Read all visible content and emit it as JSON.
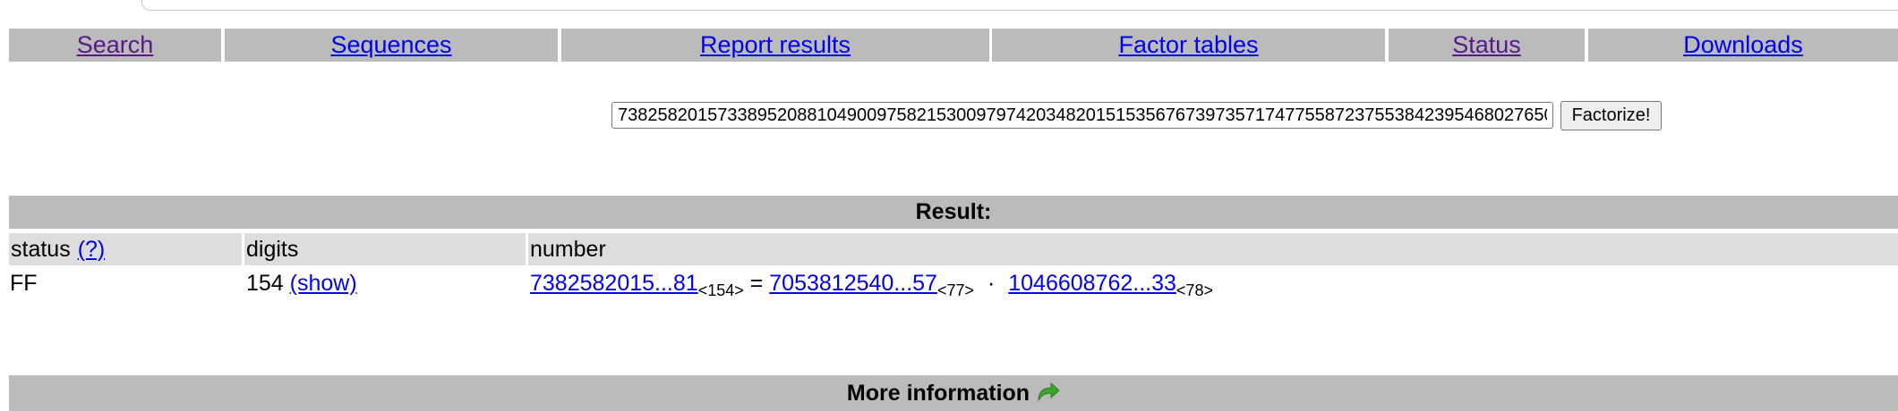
{
  "nav": {
    "items": [
      {
        "label": "Search",
        "visited": true
      },
      {
        "label": "Sequences",
        "visited": false
      },
      {
        "label": "Report results",
        "visited": false
      },
      {
        "label": "Factor tables",
        "visited": false
      },
      {
        "label": "Status",
        "visited": true
      },
      {
        "label": "Downloads",
        "visited": false
      }
    ]
  },
  "factorize": {
    "input_value": "7382582015733895208810490097582153009797420348201515356767397357174775587237553842395468027650",
    "button_label": "Factorize!"
  },
  "result": {
    "header": "Result:",
    "columns": {
      "status": "status",
      "status_help": "(?)",
      "digits": "digits",
      "number": "number"
    },
    "row": {
      "status": "FF",
      "digits": "154",
      "show": "(show)",
      "number": "7382582015...81",
      "number_sub": "<154>",
      "equals": "=",
      "factor1": "7053812540...57",
      "factor1_sub": "<77>",
      "dot": "·",
      "factor2": "1046608762...33",
      "factor2_sub": "<78>"
    }
  },
  "more_info": {
    "label": "More information",
    "icon": "green-curved-arrow-icon",
    "icon_color": "#3aa629"
  }
}
